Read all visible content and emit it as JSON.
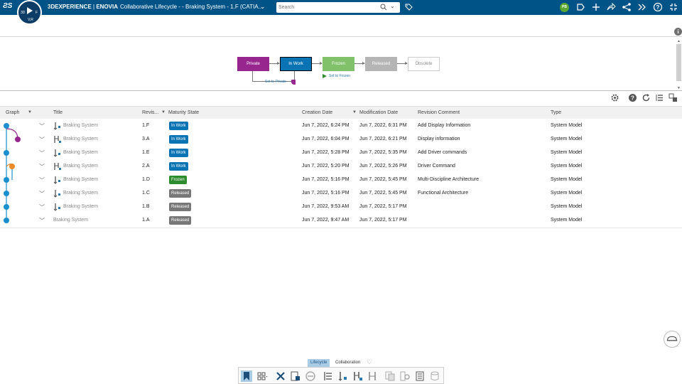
{
  "header": {
    "brand_prefix": "3DEXPERIENCE",
    "brand_separator": " | ",
    "brand_app": "ENOVIA",
    "title": "Collaborative Lifecycle - - Braking System - 1.F (CATIA...",
    "compass_left": "3D",
    "compass_right": "F",
    "compass_bottom": "V,R",
    "search_placeholder": "Search",
    "user_initials": "PB",
    "colors": {
      "topbar": "#005386",
      "accent": "#0a73b3"
    }
  },
  "lifecycle": {
    "states": [
      "Private",
      "In Work",
      "Frozen",
      "Released",
      "Obsolete"
    ],
    "current_state": "In Work",
    "promote_action": "Set to Frozen",
    "demote_action": "Set to Private"
  },
  "table": {
    "columns": [
      "Graph",
      "Title",
      "Revis...",
      "Maturity State",
      "Creation Date",
      "Modification Date",
      "Revision Comment",
      "Type"
    ],
    "rows": [
      {
        "title": "Braking System",
        "revision": "1.F",
        "state": "In Work",
        "created": "Jun 7, 2022, 6:24 PM",
        "modified": "Jun 7, 2022, 6:31 PM",
        "comment": "Add Display Information",
        "type": "System Model"
      },
      {
        "title": "Braking System",
        "revision": "3.A",
        "state": "In Work",
        "created": "Jun 7, 2022, 6:04 PM",
        "modified": "Jun 7, 2022, 6:21 PM",
        "comment": "Display information",
        "type": "System Model"
      },
      {
        "title": "Braking System",
        "revision": "1.E",
        "state": "In Work",
        "created": "Jun 7, 2022, 5:28 PM",
        "modified": "Jun 7, 2022, 5:35 PM",
        "comment": "Add Driver commands",
        "type": "System Model"
      },
      {
        "title": "Braking System",
        "revision": "2.A",
        "state": "In Work",
        "created": "Jun 7, 2022, 5:20 PM",
        "modified": "Jun 7, 2022, 5:26 PM",
        "comment": "Driver Command",
        "type": "System Model"
      },
      {
        "title": "Braking System",
        "revision": "1.D",
        "state": "Frozen",
        "created": "Jun 7, 2022, 5:16 PM",
        "modified": "Jun 7, 2022, 5:45 PM",
        "comment": "Multi-Discipline Architecture",
        "type": "System Model"
      },
      {
        "title": "Braking System",
        "revision": "1.C",
        "state": "Released",
        "created": "Jun 7, 2022, 5:16 PM",
        "modified": "Jun 7, 2022, 5:45 PM",
        "comment": "Functional Architecture",
        "type": "System Model"
      },
      {
        "title": "Braking System",
        "revision": "1.B",
        "state": "Released",
        "created": "Jun 7, 2022, 9:53 AM",
        "modified": "Jun 7, 2022, 5:17 PM",
        "comment": "",
        "type": "System Model"
      },
      {
        "title": "Braking System",
        "revision": "1.A",
        "state": "Released",
        "created": "Jun 7, 2022, 9:47 AM",
        "modified": "Jun 7, 2022, 5:17 PM",
        "comment": "",
        "type": "System Model"
      }
    ],
    "state_colors": {
      "In Work": "#0a73b3",
      "Frozen": "#2e8b2e",
      "Released": "#777777"
    },
    "graph_colors": {
      "main": "#1a8fd0",
      "branch_3": "#97278f",
      "branch_2": "#ef8a2a"
    }
  },
  "bottom": {
    "tabs": [
      "Lifecycle",
      "Collaboration"
    ],
    "active_tab": "Lifecycle"
  }
}
